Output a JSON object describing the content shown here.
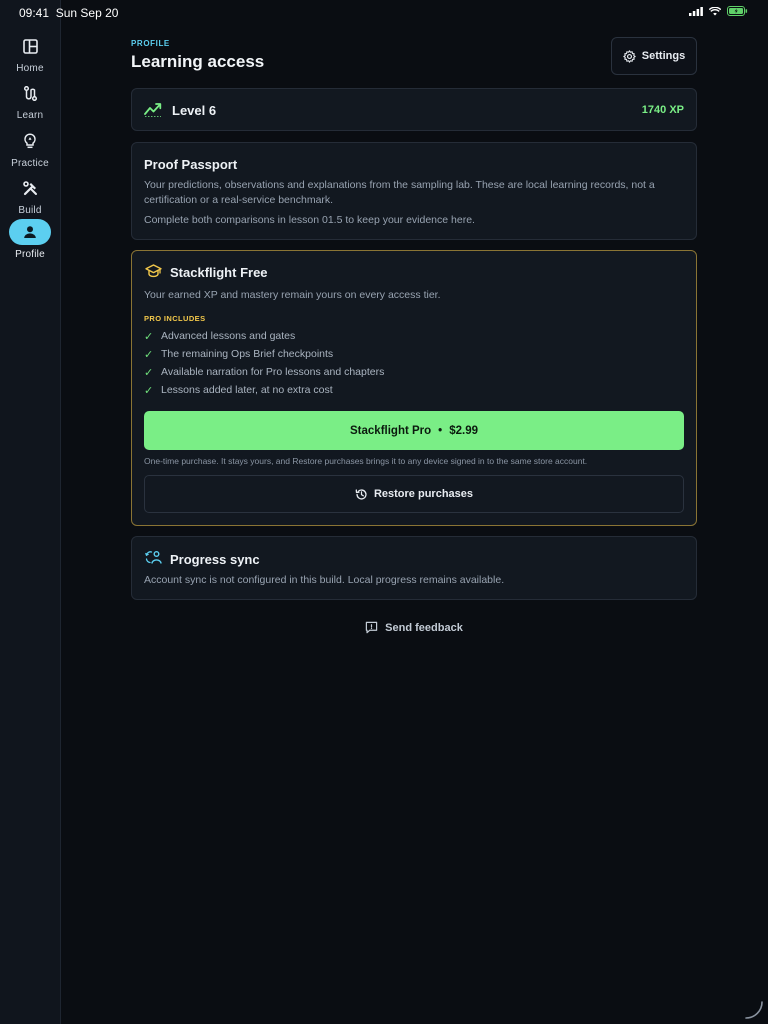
{
  "status_bar": {
    "time": "09:41",
    "date": "Sun Sep 20",
    "battery_color": "#5fd068"
  },
  "sidebar": {
    "items": [
      {
        "label": "Home",
        "icon": "layout-grid-icon",
        "active": false
      },
      {
        "label": "Learn",
        "icon": "path-icon",
        "active": false
      },
      {
        "label": "Practice",
        "icon": "lightbulb-icon",
        "active": false
      },
      {
        "label": "Build",
        "icon": "tools-icon",
        "active": false
      },
      {
        "label": "Profile",
        "icon": "person-icon",
        "active": true
      }
    ]
  },
  "header": {
    "eyebrow": "PROFILE",
    "title": "Learning access",
    "settings_label": "Settings"
  },
  "level_card": {
    "level": "Level 6",
    "xp": "1740 XP",
    "icon": "trending-up-icon"
  },
  "passport_card": {
    "title": "Proof Passport",
    "description": "Your predictions, observations and explanations from the sampling lab. These are local learning records, not a certification or a real-service benchmark.",
    "hint": "Complete both comparisons in lesson 01.5 to keep your evidence here."
  },
  "access_card": {
    "title": "Stackflight Free",
    "subtitle": "Your earned XP and mastery remain yours on every access tier.",
    "pro_includes_label": "PRO INCLUDES",
    "features": [
      "Advanced lessons and gates",
      "The remaining Ops Brief checkpoints",
      "Available narration for Pro lessons and chapters",
      "Lessons added later, at no extra cost"
    ],
    "buy_label": "Stackflight Pro",
    "buy_separator": "•",
    "price": "$2.99",
    "fine_print": "One-time purchase. It stays yours, and Restore purchases brings it to any device signed in to the same store account.",
    "restore_label": "Restore purchases"
  },
  "sync_card": {
    "title": "Progress sync",
    "description": "Account sync is not configured in this build. Local progress remains available."
  },
  "feedback": {
    "label": "Send feedback"
  },
  "colors": {
    "accent": "#5ccff0",
    "success": "#7aee86",
    "warning": "#f2c84b",
    "background": "#0a0d12"
  }
}
